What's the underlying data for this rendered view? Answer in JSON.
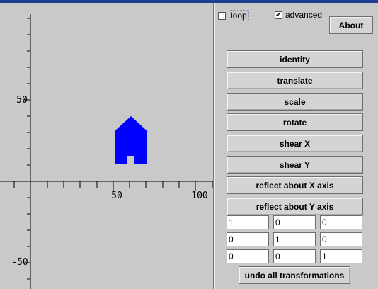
{
  "canvas": {
    "x_tick_labels": [
      "50",
      "100"
    ],
    "y_tick_labels": [
      "50",
      "-50"
    ],
    "shape_color": "#0000ff",
    "axis_color": "#000000"
  },
  "controls": {
    "loop": {
      "label": "loop",
      "checked": false
    },
    "advanced": {
      "label": "advanced",
      "checked": true,
      "check_glyph": "✔"
    },
    "about_label": "About",
    "transform_buttons": [
      "identity",
      "translate",
      "scale",
      "rotate",
      "shear X",
      "shear Y",
      "reflect about X axis",
      "reflect about Y axis"
    ],
    "matrix": [
      [
        "1",
        "0",
        "0"
      ],
      [
        "0",
        "1",
        "0"
      ],
      [
        "0",
        "0",
        "1"
      ]
    ],
    "undo_label": "undo all transformations"
  }
}
